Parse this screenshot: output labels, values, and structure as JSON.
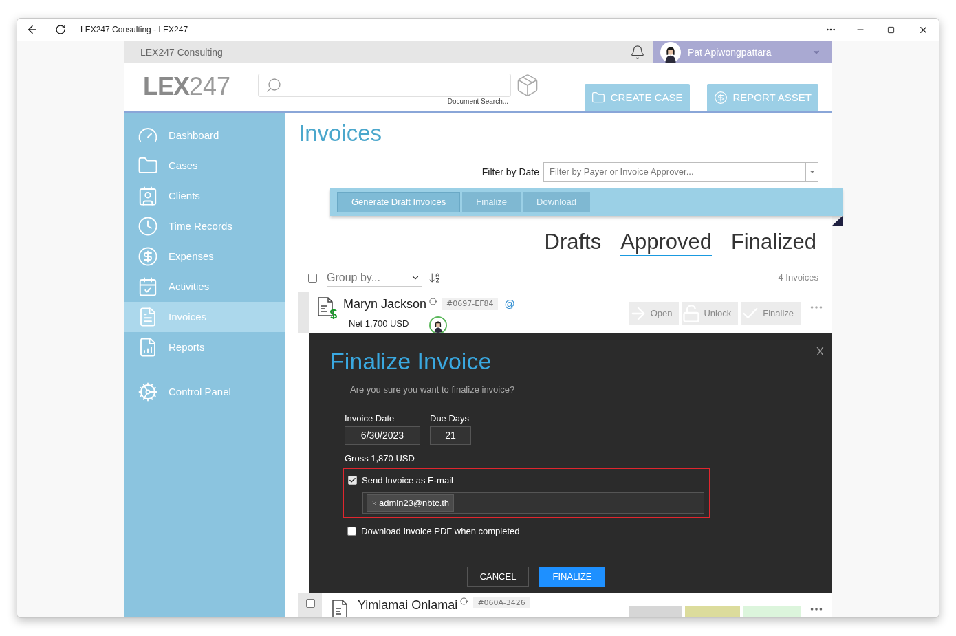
{
  "window": {
    "title": "LEX247 Consulting - LEX247"
  },
  "topbar": {
    "org_name": "LEX247 Consulting",
    "user_name": "Pat Apiwongpattara"
  },
  "header": {
    "logo_bold": "LEX",
    "logo_light": "247",
    "search_caption": "Document Search...",
    "buttons": [
      {
        "label": "CREATE CASE",
        "kind": "folder"
      },
      {
        "label": "REPORT ASSET",
        "kind": "dollar"
      }
    ]
  },
  "sidebar": {
    "items": [
      {
        "label": "Dashboard",
        "kind": "gauge",
        "selected": false
      },
      {
        "label": "Cases",
        "kind": "folder",
        "selected": false
      },
      {
        "label": "Clients",
        "kind": "contacts",
        "selected": false
      },
      {
        "label": "Time Records",
        "kind": "clock",
        "selected": false
      },
      {
        "label": "Expenses",
        "kind": "dollar",
        "selected": false
      },
      {
        "label": "Activities",
        "kind": "calendar",
        "selected": false
      },
      {
        "label": "Invoices",
        "kind": "invoice",
        "selected": true
      },
      {
        "label": "Reports",
        "kind": "report",
        "selected": false
      },
      {
        "label": "Control Panel",
        "kind": "gears",
        "selected": false
      }
    ]
  },
  "page_title": "Invoices",
  "filter": {
    "label": "Filter by Date",
    "placeholder": "Filter by Payer or Invoice Approver..."
  },
  "toolbar": [
    {
      "label": "Generate Draft Invoices",
      "disabled": false
    },
    {
      "label": "Finalize",
      "disabled": true
    },
    {
      "label": "Download",
      "disabled": true
    }
  ],
  "status_tabs": [
    {
      "label": "Drafts",
      "selected": false
    },
    {
      "label": "Approved",
      "selected": true
    },
    {
      "label": "Finalized",
      "selected": false
    }
  ],
  "list": {
    "select_all": false,
    "group_by_placeholder": "Group by...",
    "count": "4 Invoices"
  },
  "invoices": [
    {
      "name": "Maryn Jackson",
      "id": "#0697-EF84",
      "net": "Net 1,700 USD",
      "email_mark": "@",
      "actions": [
        {
          "label": "Open",
          "kind": "open"
        },
        {
          "label": "Unlock",
          "kind": "unlock"
        },
        {
          "label": "Finalize",
          "kind": "finalize"
        }
      ]
    },
    {
      "name": "Yimlamai Onlamai",
      "id": "#060A-3426",
      "checked": false
    }
  ],
  "modal": {
    "title": "Finalize Invoice",
    "close": "X",
    "message": "Are you sure you want to finalize invoice?",
    "invoice_date": {
      "label": "Invoice Date",
      "value": "6/30/2023"
    },
    "due_days": {
      "label": "Due Days",
      "value": "21"
    },
    "gross": "Gross 1,870 USD",
    "send_email": {
      "label": "Send Invoice as E-mail",
      "checked": true
    },
    "emails": [
      "admin23@nbtc.th"
    ],
    "download_pdf": {
      "label": "Download Invoice PDF when completed",
      "checked": false
    },
    "buttons": [
      {
        "label": "CANCEL",
        "kind": "secondary"
      },
      {
        "label": "FINALIZE",
        "kind": "primary"
      }
    ]
  }
}
